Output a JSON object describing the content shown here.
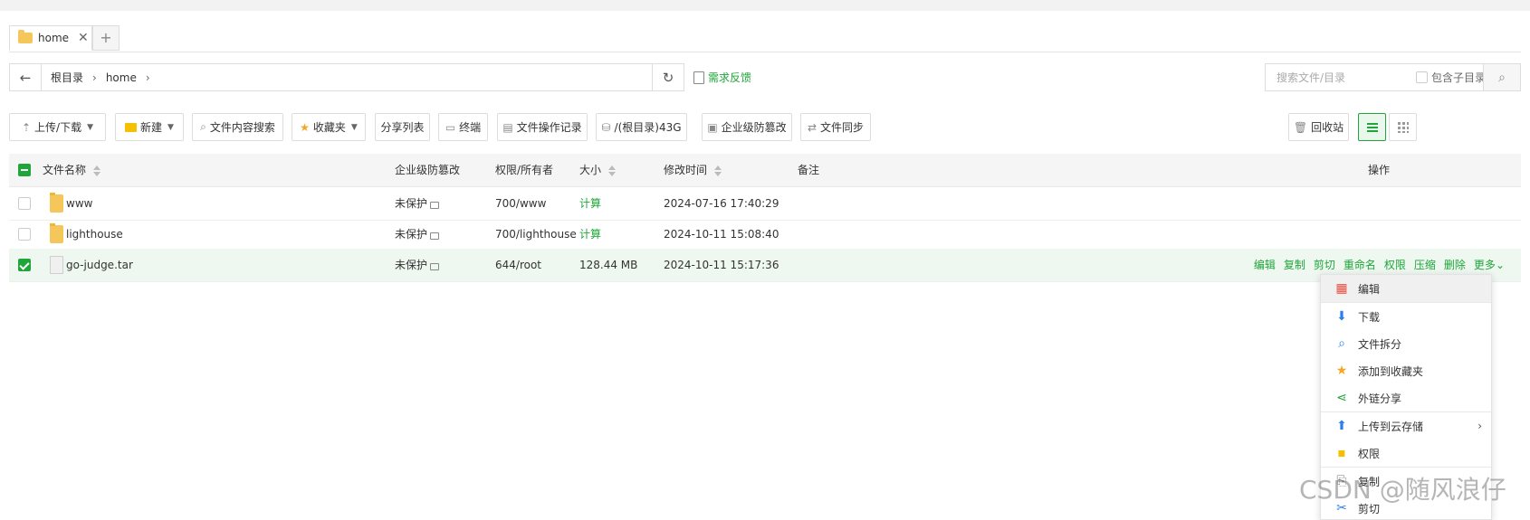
{
  "tabs": [
    {
      "label": "home"
    }
  ],
  "tab_add": "+",
  "tab_close": "✕",
  "breadcrumb": {
    "items": [
      "根目录",
      "home"
    ]
  },
  "feedback_label": "需求反馈",
  "search": {
    "placeholder": "搜索文件/目录",
    "include_subdir": "包含子目录"
  },
  "toolbar": {
    "upload": "上传/下载",
    "new": "新建",
    "content_search": "文件内容搜索",
    "favorites": "收藏夹",
    "share_list": "分享列表",
    "terminal": "终端",
    "op_log": "文件操作记录",
    "disk": "/(根目录)43G",
    "tamper": "企业级防篡改",
    "sync": "文件同步",
    "recycle": "回收站"
  },
  "table": {
    "headers": {
      "name": "文件名称",
      "tamper": "企业级防篡改",
      "perm": "权限/所有者",
      "size": "大小",
      "mtime": "修改时间",
      "note": "备注",
      "ops": "操作"
    },
    "rows": [
      {
        "type": "folder",
        "name": "www",
        "tamper": "未保护",
        "perm": "700/www",
        "size": "计算",
        "mtime": "2024-07-16 17:40:29",
        "selected": false
      },
      {
        "type": "folder",
        "name": "lighthouse",
        "tamper": "未保护",
        "perm": "700/lighthouse",
        "size": "计算",
        "mtime": "2024-10-11 15:08:40",
        "selected": false
      },
      {
        "type": "file",
        "name": "go-judge.tar",
        "tamper": "未保护",
        "perm": "644/root",
        "size": "128.44 MB",
        "mtime": "2024-10-11 15:17:36",
        "selected": true
      }
    ],
    "row_ops": [
      "编辑",
      "复制",
      "剪切",
      "重命名",
      "权限",
      "压缩",
      "删除",
      "更多"
    ]
  },
  "context_menu": {
    "items": [
      {
        "label": "编辑",
        "icon": "edit-icon"
      },
      {
        "label": "下载",
        "icon": "download-icon"
      },
      {
        "label": "文件拆分",
        "icon": "split-icon"
      },
      {
        "label": "添加到收藏夹",
        "icon": "star-icon"
      },
      {
        "label": "外链分享",
        "icon": "share-icon"
      },
      {
        "label": "上传到云存储",
        "icon": "upload-cloud-icon"
      },
      {
        "label": "权限",
        "icon": "permission-icon"
      },
      {
        "label": "复制",
        "icon": "copy-icon"
      },
      {
        "label": "剪切",
        "icon": "cut-icon"
      }
    ]
  },
  "watermark": "CSDN @随风浪仔",
  "colors": {
    "accent": "#20a53a",
    "folder": "#f5c75a"
  }
}
